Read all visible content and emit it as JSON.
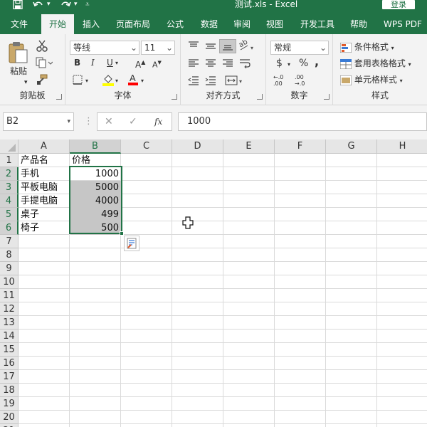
{
  "title_bar": {
    "title": "测试.xls - Excel",
    "login": "登录",
    "save_icon": "save-icon",
    "undo_icon": "undo-icon",
    "redo_icon": "redo-icon",
    "qat_icon": "customize-qat-icon"
  },
  "tabs": [
    "文件",
    "开始",
    "插入",
    "页面布局",
    "公式",
    "数据",
    "审阅",
    "视图",
    "开发工具",
    "帮助",
    "WPS PDF"
  ],
  "active_tab": "开始",
  "ribbon": {
    "clipboard": {
      "paste_label": "粘贴",
      "group_label": "剪贴板"
    },
    "font": {
      "font_name": "等线",
      "font_size": "11",
      "bold": "B",
      "italic": "I",
      "underline": "U",
      "grow": "A",
      "shrink": "A",
      "wen": "文",
      "group_label": "字体"
    },
    "alignment": {
      "group_label": "对齐方式"
    },
    "number": {
      "format": "常规",
      "currency": "$",
      "percent": "%",
      "comma": ",",
      "inc_decimal": "←.0 .00",
      "dec_decimal": ".00 →.0",
      "group_label": "数字"
    },
    "styles": {
      "conditional": "条件格式",
      "table": "套用表格格式",
      "cell_styles": "单元格样式",
      "group_label": "样式"
    }
  },
  "formula_bar": {
    "name_box": "B2",
    "fx": "fx",
    "cancel": "✕",
    "enter": "✓",
    "formula": "1000"
  },
  "columns": [
    "A",
    "B",
    "C",
    "D",
    "E",
    "F",
    "G",
    "H"
  ],
  "rows": [
    "1",
    "2",
    "3",
    "4",
    "5",
    "6",
    "7",
    "8",
    "9",
    "10",
    "11",
    "12",
    "13",
    "14",
    "15",
    "16",
    "17",
    "18",
    "19",
    "20",
    "21"
  ],
  "cells": {
    "A1": "产品名",
    "B1": "价格",
    "A2": "手机",
    "B2": "1000",
    "A3": "平板电脑",
    "B3": "5000",
    "A4": "手提电脑",
    "B4": "4000",
    "A5": "桌子",
    "B5": "499",
    "A6": "椅子",
    "B6": "500"
  },
  "selection": "B2:B6",
  "colors": {
    "accent": "#217346",
    "selection_fill": "#c6c6c6"
  }
}
